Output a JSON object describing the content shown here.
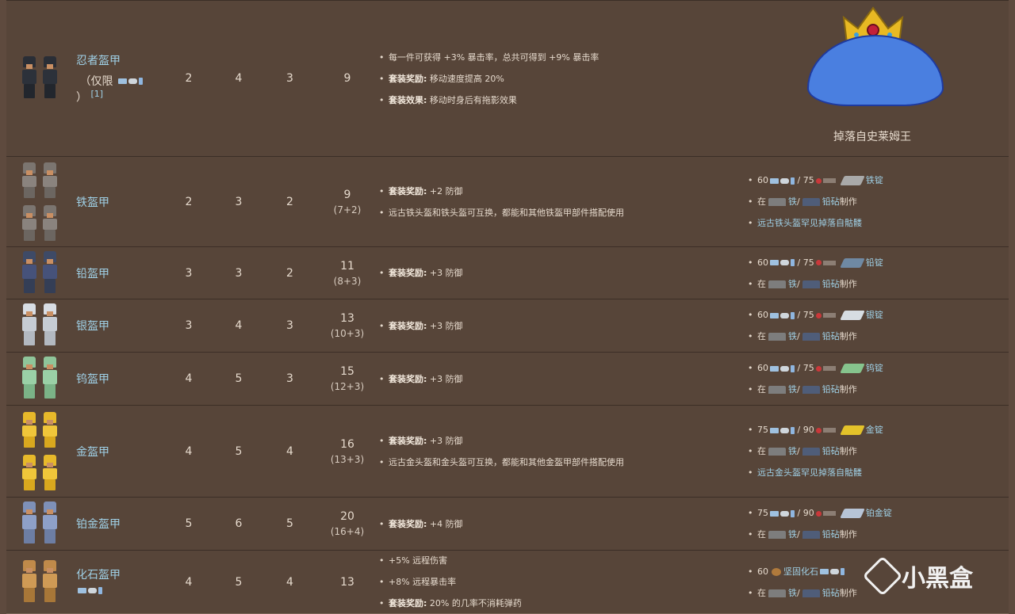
{
  "rows": [
    {
      "name": "忍者盔甲",
      "name_sub": "（仅限",
      "name_tail": "）",
      "footnote": "[1]",
      "head": "2",
      "body": "4",
      "legs": "3",
      "total": "9",
      "total_sub": "",
      "bonus": [
        {
          "text": "每一件可获得 +3% 暴击率，总共可得到 +9% 暴击率"
        },
        {
          "label": "套装奖励:",
          "text": "移动速度提高 20%"
        },
        {
          "label": "套装效果:",
          "text": "移动时身后有拖影效果"
        }
      ],
      "source_note": "掉落自史莱姆王",
      "colors": {
        "helm": "#2a2e36",
        "torso": "#2c313a",
        "legs": "#22262d"
      }
    },
    {
      "name": "铁盔甲",
      "head": "2",
      "body": "3",
      "legs": "2",
      "total": "9",
      "total_sub": "(7+2)",
      "bonus": [
        {
          "label": "套装奖励:",
          "text": "+2 防御"
        },
        {
          "text": "远古铁头盔和铁头盔可互换，都能和其他铁盔甲部件搭配使用"
        }
      ],
      "source": {
        "cost1": "60",
        "cost2": "75",
        "bar_name": "铁锭",
        "bar_color": "#a9a9a9",
        "craft_prefix": "在",
        "anvil1": "铁",
        "anvil2": "铅砧",
        "craft_suffix": "制作",
        "extra": "远古铁头盔罕见掉落自骷髅"
      },
      "colors": {
        "helm": "#7b7570",
        "torso": "#8a837e",
        "legs": "#6c6661"
      }
    },
    {
      "name": "铅盔甲",
      "head": "3",
      "body": "3",
      "legs": "2",
      "total": "11",
      "total_sub": "(8+3)",
      "bonus": [
        {
          "label": "套装奖励:",
          "text": "+3 防御"
        }
      ],
      "source": {
        "cost1": "60",
        "cost2": "75",
        "bar_name": "铅锭",
        "bar_color": "#6f89a3",
        "craft_prefix": "在",
        "anvil1": "铁",
        "anvil2": "铅砧",
        "craft_suffix": "制作"
      },
      "colors": {
        "helm": "#3e4a66",
        "torso": "#46527a",
        "legs": "#343e56"
      }
    },
    {
      "name": "银盔甲",
      "head": "3",
      "body": "4",
      "legs": "3",
      "total": "13",
      "total_sub": "(10+3)",
      "bonus": [
        {
          "label": "套装奖励:",
          "text": "+3 防御"
        }
      ],
      "source": {
        "cost1": "60",
        "cost2": "75",
        "bar_name": "银锭",
        "bar_color": "#d7dde2",
        "craft_prefix": "在",
        "anvil1": "铁",
        "anvil2": "铅砧",
        "craft_suffix": "制作"
      },
      "colors": {
        "helm": "#d8dde4",
        "torso": "#c6ccd4",
        "legs": "#b3b9c1"
      }
    },
    {
      "name": "钨盔甲",
      "head": "4",
      "body": "5",
      "legs": "3",
      "total": "15",
      "total_sub": "(12+3)",
      "bonus": [
        {
          "label": "套装奖励:",
          "text": "+3 防御"
        }
      ],
      "source": {
        "cost1": "60",
        "cost2": "75",
        "bar_name": "钨锭",
        "bar_color": "#86c48d",
        "craft_prefix": "在",
        "anvil1": "铁",
        "anvil2": "铅砧",
        "craft_suffix": "制作"
      },
      "colors": {
        "helm": "#8fc59a",
        "torso": "#9ad0a6",
        "legs": "#7bb387"
      }
    },
    {
      "name": "金盔甲",
      "head": "4",
      "body": "5",
      "legs": "4",
      "total": "16",
      "total_sub": "(13+3)",
      "bonus": [
        {
          "label": "套装奖励:",
          "text": "+3 防御"
        },
        {
          "text": "远古金头盔和金头盔可互换，都能和其他金盔甲部件搭配使用"
        }
      ],
      "source": {
        "cost1": "75",
        "cost2": "90",
        "bar_name": "金锭",
        "bar_color": "#e3c22a",
        "craft_prefix": "在",
        "anvil1": "铁",
        "anvil2": "铅砧",
        "craft_suffix": "制作",
        "extra": "远古金头盔罕见掉落自骷髅"
      },
      "colors": {
        "helm": "#e7b92a",
        "torso": "#f0c63a",
        "legs": "#d9a81e"
      }
    },
    {
      "name": "铂金盔甲",
      "head": "5",
      "body": "6",
      "legs": "5",
      "total": "20",
      "total_sub": "(16+4)",
      "bonus": [
        {
          "label": "套装奖励:",
          "text": "+4 防御"
        }
      ],
      "source": {
        "cost1": "75",
        "cost2": "90",
        "bar_name": "铂金锭",
        "bar_color": "#b7c4d6",
        "craft_prefix": "在",
        "anvil1": "铁",
        "anvil2": "铅砧",
        "craft_suffix": "制作"
      },
      "colors": {
        "helm": "#7e90b8",
        "torso": "#8ea0c8",
        "legs": "#6d7ea4"
      }
    },
    {
      "name": "化石盔甲",
      "head": "4",
      "body": "5",
      "legs": "4",
      "total": "13",
      "total_sub": "",
      "bonus": [
        {
          "text": "+5% 远程伤害"
        },
        {
          "text": "+8% 远程暴击率"
        },
        {
          "label": "套装奖励:",
          "text": "20% 的几率不消耗弹药"
        }
      ],
      "source": {
        "cost1": "60",
        "material": "坚固化石",
        "craft_prefix": "在",
        "anvil1": "铁",
        "anvil2": "铅砧",
        "craft_suffix": "制作"
      },
      "colors": {
        "helm": "#c08a4a",
        "torso": "#cf9a55",
        "legs": "#a87738"
      }
    }
  ],
  "watermark": "小黑盒"
}
